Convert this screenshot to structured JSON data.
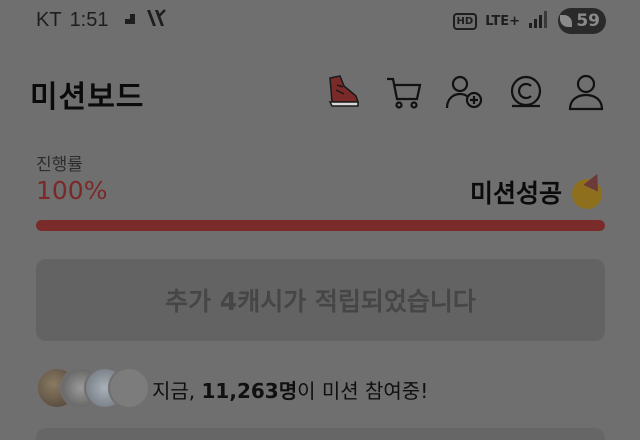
{
  "status_bar": {
    "carrier": "KT",
    "time": "1:51",
    "hd": "HD",
    "network": "LTE+",
    "battery": "59"
  },
  "header": {
    "title": "미션보드",
    "icons": [
      "sneaker-icon",
      "cart-icon",
      "add-friend-icon",
      "cash-coin-icon",
      "profile-icon"
    ]
  },
  "progress": {
    "label": "진행률",
    "value_text": "100%",
    "value": 100,
    "status": "미션성공"
  },
  "notice": {
    "text": "추가 4캐시가 적립되었습니다"
  },
  "participants": {
    "prefix": "지금, ",
    "count": "11,263명",
    "suffix": "이 미션 참여중!"
  },
  "colors": {
    "accent": "#7b2a2a",
    "overlay": "#6f6f6f"
  }
}
